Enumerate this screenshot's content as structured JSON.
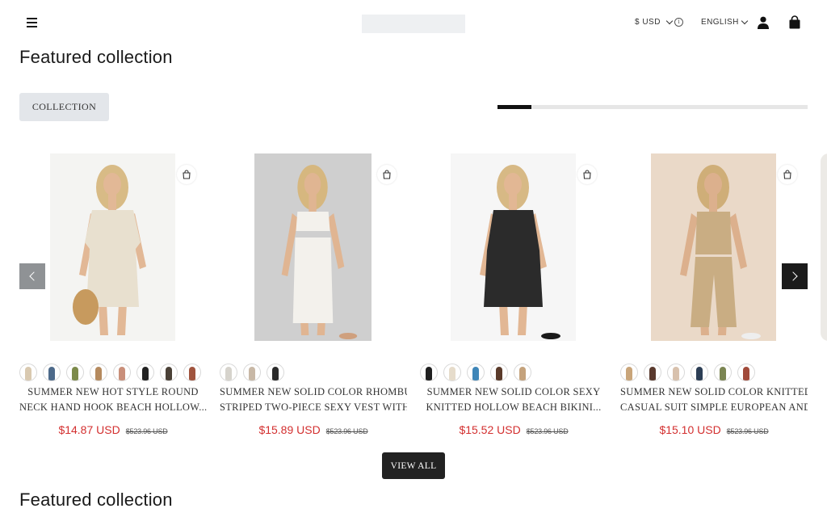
{
  "header": {
    "currency": "$ USD",
    "language": "ENGLISH",
    "icons": [
      "menu-icon",
      "info-icon",
      "user-icon",
      "bag-icon"
    ]
  },
  "section": {
    "title": "Featured collection",
    "collection_button": "COLLECTION",
    "slider_progress": 0.11,
    "view_all": "VIEW ALL",
    "next_title": "Featured collection"
  },
  "products": [
    {
      "title_line1": "SUMMER NEW HOT STYLE ROUND",
      "title_line2": "NECK HAND HOOK BEACH HOLLOW...",
      "price": "$14.87 USD",
      "compare_price": "$523.96 USD",
      "swatch_colors": [
        "#d9c9b0",
        "#4d6a8a",
        "#7c8a4a",
        "#b58a5e",
        "#c98f7a",
        "#222222",
        "#4a4036",
        "#a0543e"
      ],
      "photo_colors": {
        "bg": "#f4f4f2",
        "garment": "#e8e0cf",
        "skin": "#e2b896",
        "hair": "#d8bb86",
        "accent": "#c79a5e"
      }
    },
    {
      "title_line1": "SUMMER NEW SOLID COLOR RHOMBUS",
      "title_line2": "STRIPED TWO-PIECE SEXY VEST WITH...",
      "price": "$15.89 USD",
      "compare_price": "$523.96 USD",
      "swatch_colors": [
        "#d6d3cc",
        "#c8b8a6",
        "#2a2a2a"
      ],
      "photo_colors": {
        "bg": "#cfcfcf",
        "garment": "#f3f1ec",
        "skin": "#e0b592",
        "hair": "#d6b77f",
        "accent": "#cfa07e"
      }
    },
    {
      "title_line1": "SUMMER NEW SOLID COLOR SEXY",
      "title_line2": "KNITTED HOLLOW BEACH BIKINI...",
      "price": "$15.52 USD",
      "compare_price": "$523.96 USD",
      "swatch_colors": [
        "#1f1f1f",
        "#e6dccb",
        "#3f86b8",
        "#5a3a2a",
        "#c4a27c"
      ],
      "photo_colors": {
        "bg": "#f6f6f6",
        "garment": "#2b2b2b",
        "skin": "#e2b794",
        "hair": "#d7b985",
        "accent": "#1a1a1a"
      }
    },
    {
      "title_line1": "SUMMER NEW SOLID COLOR KNITTED",
      "title_line2": "CASUAL SUIT SIMPLE EUROPEAN AND...",
      "price": "$15.10 USD",
      "compare_price": "$523.96 USD",
      "swatch_colors": [
        "#c9a57a",
        "#5a3a2e",
        "#d8c1ad",
        "#2c3e55",
        "#7b8552",
        "#a14a3a"
      ],
      "photo_colors": {
        "bg": "#ead9c8",
        "garment": "#c9ad83",
        "skin": "#dcb08d",
        "hair": "#cfae78",
        "accent": "#eeeeee"
      }
    }
  ]
}
